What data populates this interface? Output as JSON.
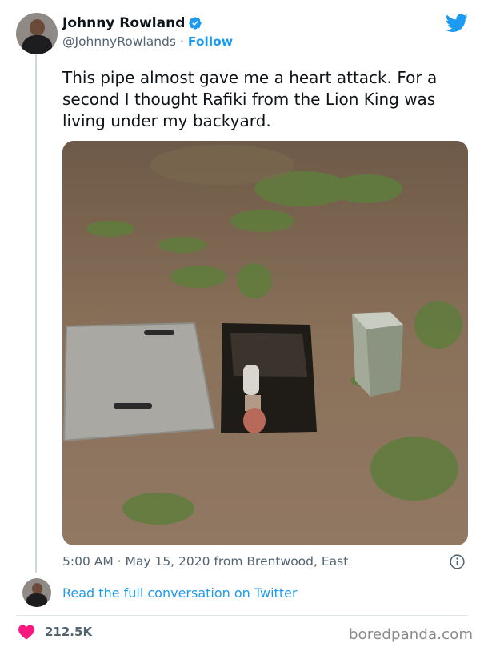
{
  "author": {
    "name": "Johnny Rowland",
    "handle": "@JohnnyRowlands",
    "separator": "·",
    "follow_label": "Follow",
    "verified": true
  },
  "tweet": {
    "text": "This pipe almost gave me a heart attack. For a second I thought Rafiki from the Lion King was living under my backyard.",
    "timestamp": "5:00 AM · May 15, 2020 from Brentwood, East"
  },
  "footer": {
    "read_more": "Read the full conversation on Twitter",
    "likes": "212.5K"
  },
  "watermark": "boredpanda.com",
  "colors": {
    "accent": "#1d9bf0",
    "like": "#f91880",
    "muted": "#536471"
  },
  "icons": [
    "verified-badge-icon",
    "twitter-bird-icon",
    "info-icon",
    "heart-icon"
  ]
}
